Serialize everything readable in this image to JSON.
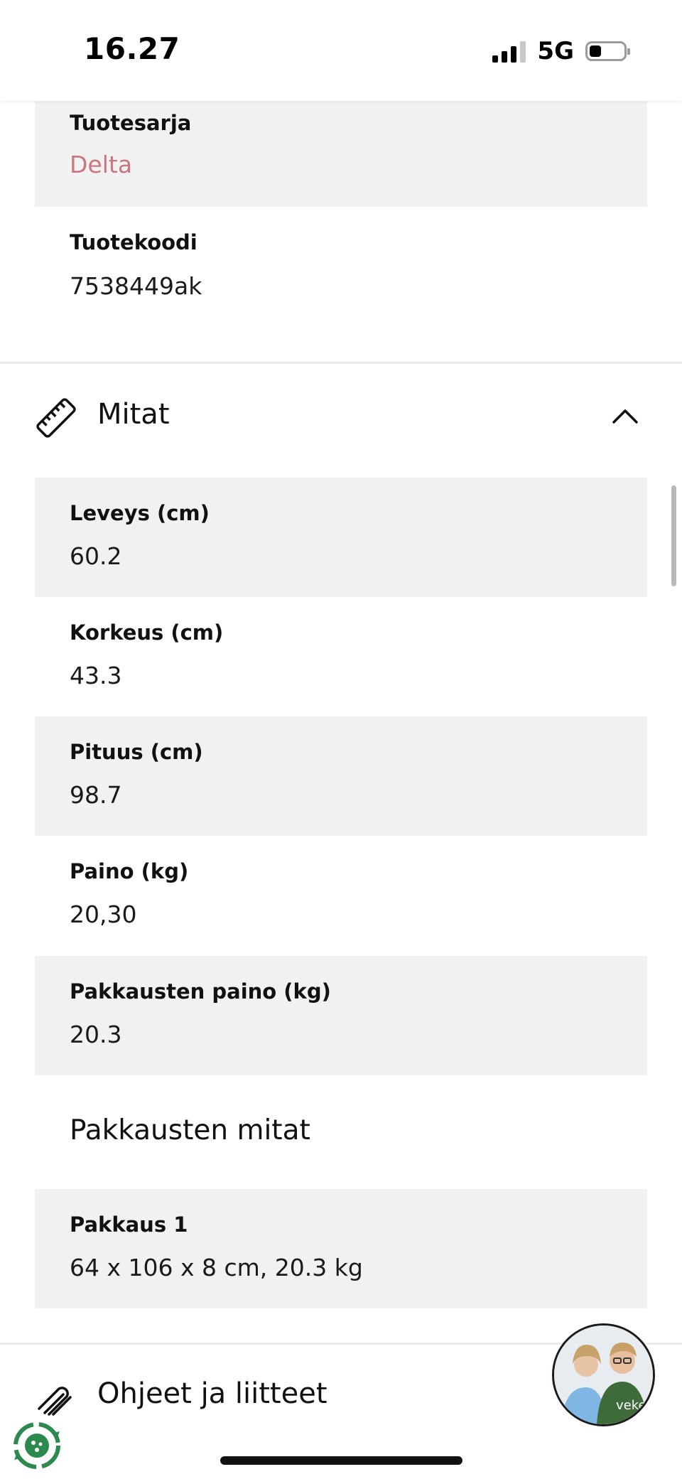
{
  "status_bar": {
    "time": "16.27",
    "network": "5G"
  },
  "product_info": [
    {
      "label": "Tuotesarja",
      "value": "Delta"
    },
    {
      "label": "Tuotekoodi",
      "value": "7538449ak"
    }
  ],
  "dimensions": {
    "title": "Mitat",
    "rows": [
      {
        "label": "Leveys (cm)",
        "value": "60.2"
      },
      {
        "label": "Korkeus (cm)",
        "value": "43.3"
      },
      {
        "label": "Pituus (cm)",
        "value": "98.7"
      },
      {
        "label": "Paino (kg)",
        "value": "20,30"
      },
      {
        "label": "Pakkausten paino (kg)",
        "value": "20.3"
      }
    ],
    "packages_title": "Pakkausten mitat",
    "packages": [
      {
        "label": "Pakkaus 1",
        "value": "64 x 106 x 8 cm, 20.3 kg"
      }
    ]
  },
  "attachments": {
    "title": "Ohjeet ja liitteet"
  },
  "chat_avatar": {
    "logo_text": "veke"
  },
  "colors": {
    "accent": "#c9767f",
    "row_shade": "#f1f1f1"
  }
}
